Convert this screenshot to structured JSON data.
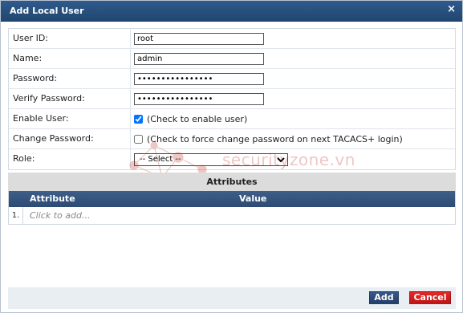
{
  "dialog": {
    "title": "Add Local User",
    "close_glyph": "×"
  },
  "form": {
    "user_id": {
      "label": "User ID:",
      "value": "root"
    },
    "name": {
      "label": "Name:",
      "value": "admin"
    },
    "password": {
      "label": "Password:",
      "value": "••••••••••••••••"
    },
    "verify_password": {
      "label": "Verify Password:",
      "value": "••••••••••••••••"
    },
    "enable_user": {
      "label": "Enable User:",
      "checked": true,
      "text": "(Check to enable user)"
    },
    "change_password": {
      "label": "Change Password:",
      "checked": false,
      "text": "(Check to force change password on next TACACS+ login)"
    },
    "role": {
      "label": "Role:",
      "selected": "-- Select --"
    }
  },
  "watermark": {
    "text": "securityzone.vn"
  },
  "attributes": {
    "section_title": "Attributes",
    "columns": [
      "Attribute",
      "Value"
    ],
    "rows": [
      {
        "index": "1.",
        "placeholder": "Click to add..."
      }
    ]
  },
  "footer": {
    "add_label": "Add",
    "cancel_label": "Cancel"
  },
  "colors": {
    "titlebar": "#2a5282",
    "table_header": "#35557f",
    "add_button": "#2d4c7a",
    "cancel_button": "#d41f1f",
    "footer_bg": "#e9eef3"
  }
}
